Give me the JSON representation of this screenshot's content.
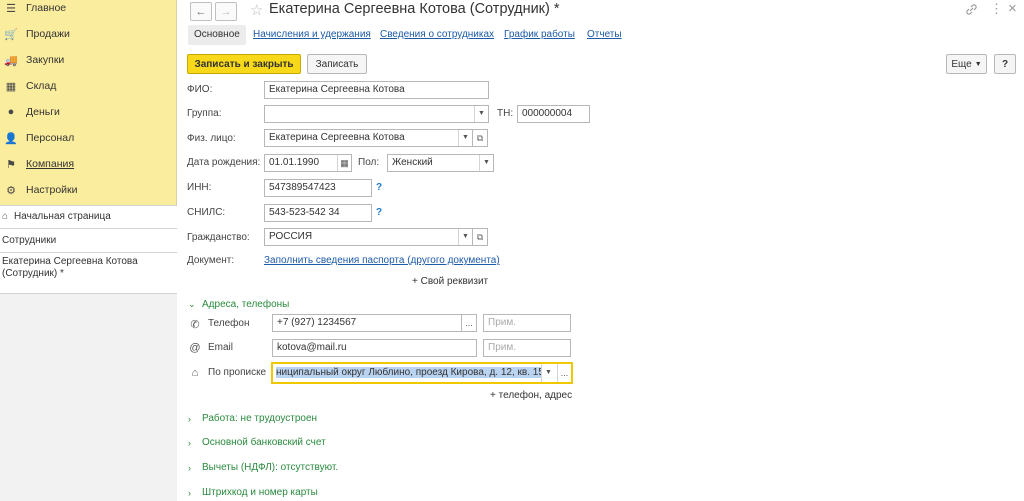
{
  "sidebar": {
    "items": [
      {
        "label": "Главное",
        "icon": "menu-icon"
      },
      {
        "label": "Продажи",
        "icon": "sales-icon"
      },
      {
        "label": "Закупки",
        "icon": "purchases-icon"
      },
      {
        "label": "Склад",
        "icon": "warehouse-icon"
      },
      {
        "label": "Деньги",
        "icon": "money-icon"
      },
      {
        "label": "Персонал",
        "icon": "person-icon"
      },
      {
        "label": "Компания",
        "icon": "flag-icon"
      },
      {
        "label": "Настройки",
        "icon": "gear-icon"
      }
    ],
    "home": "Начальная страница",
    "open_windows": [
      "Сотрудники",
      "Екатерина Сергеевна Котова (Сотрудник) *"
    ]
  },
  "header": {
    "title": "Екатерина Сергеевна Котова (Сотрудник) *",
    "back_icon": "←",
    "forward_icon": "→",
    "link_icon": "🔗",
    "more_icon": "⋮",
    "close_icon": "×"
  },
  "tabs": [
    "Основное",
    "Начисления и удержания",
    "Сведения о сотрудниках",
    "График работы",
    "Отчеты"
  ],
  "toolbar": {
    "save_close": "Записать и закрыть",
    "save": "Записать",
    "more": "Еще",
    "help": "?"
  },
  "form": {
    "fio_label": "ФИО:",
    "fio_value": "Екатерина Сергеевна Котова",
    "group_label": "Группа:",
    "group_value": "",
    "tn_label": "ТН:",
    "tn_value": "000000004",
    "person_label": "Физ. лицо:",
    "person_value": "Екатерина Сергеевна Котова",
    "birth_label": "Дата рождения:",
    "birth_value": "01.01.1990",
    "sex_label": "Пол:",
    "sex_value": "Женский",
    "inn_label": "ИНН:",
    "inn_value": "547389547423",
    "snils_label": "СНИЛС:",
    "snils_value": "543-523-542 34",
    "citizenship_label": "Гражданство:",
    "citizenship_value": "РОССИЯ",
    "document_label": "Документ:",
    "document_link": "Заполнить сведения паспорта (другого документа)",
    "add_attr": "+ Свой реквизит",
    "help_mark": "?"
  },
  "contacts": {
    "header": "Адреса, телефоны",
    "phone_label": "Телефон",
    "phone_value": "+7 (927) 1234567",
    "email_label": "Email",
    "email_value": "kotova@mail.ru",
    "address_label": "По прописке",
    "address_value": "ниципальный округ Люблино, проезд Кирова, д. 12, кв. 15",
    "note_placeholder": "Прим.",
    "add_contact": "+ телефон, адрес",
    "ellipsis": "..."
  },
  "groups": [
    "Работа: не трудоустроен",
    "Основной банковский счет",
    "Вычеты (НДФЛ): отсутствуют.",
    "Штрихкод и номер карты"
  ]
}
